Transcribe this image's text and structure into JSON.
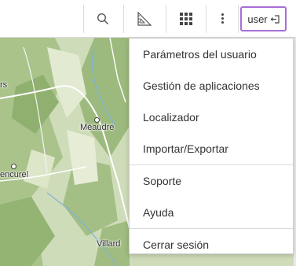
{
  "toolbar": {
    "search_icon": "search-icon",
    "measure_icon": "measure-ruler-icon",
    "apps_icon": "apps-grid-icon",
    "more_icon": "kebab-menu-icon",
    "user_label": "user",
    "logout_icon": "sign-in-icon",
    "accent_color": "#a86ed6"
  },
  "map": {
    "places": [
      "rs",
      "Méaudre",
      "encurel",
      "Villard"
    ]
  },
  "user_menu": {
    "items": [
      "Parámetros del usuario",
      "Gestión de aplicaciones",
      "Localizador",
      "Importar/Exportar",
      "Soporte",
      "Ayuda",
      "Cerrar sesión"
    ]
  }
}
